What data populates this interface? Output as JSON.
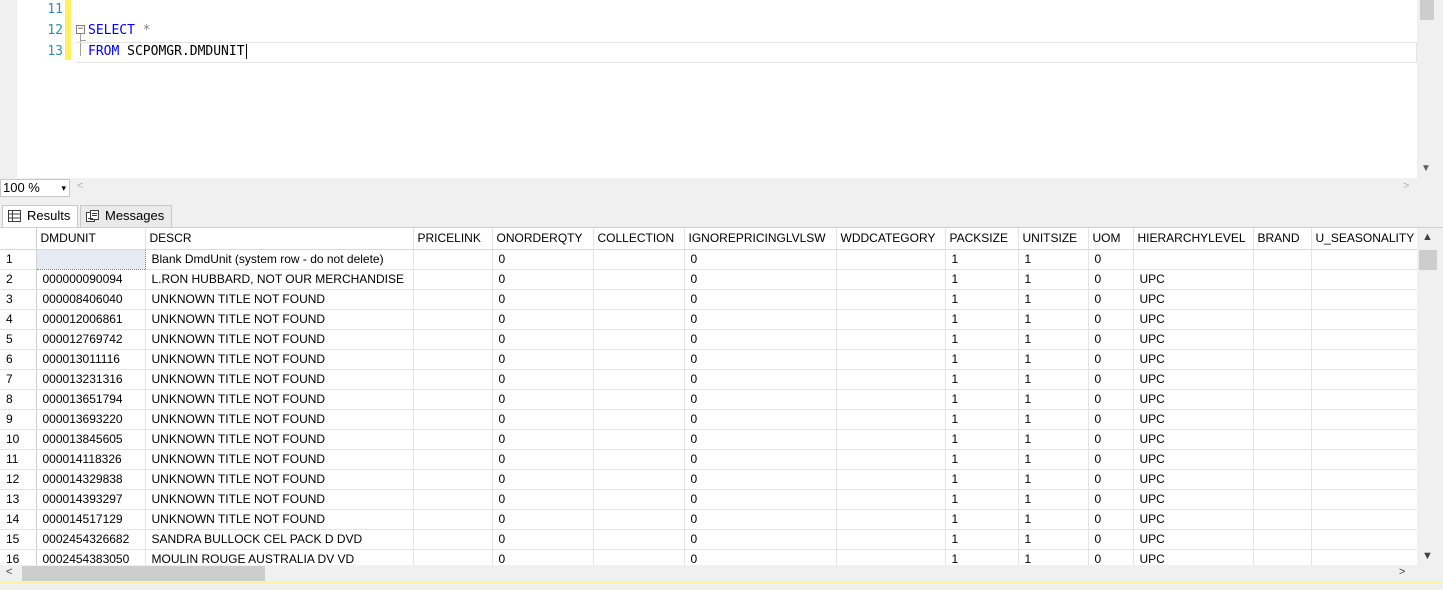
{
  "editor": {
    "line_numbers": [
      "11",
      "12",
      "13"
    ],
    "code": {
      "select_kw": "SELECT",
      "star": "*",
      "from_kw": "FROM",
      "table_name": "SCPOMGR.DMDUNIT"
    },
    "fold_glyph": "−"
  },
  "zoom": {
    "value": "100 %",
    "dropdown_glyph": "▾"
  },
  "tabs": {
    "results": "Results",
    "messages": "Messages"
  },
  "grid": {
    "columns": [
      "DMDUNIT",
      "DESCR",
      "PRICELINK",
      "ONORDERQTY",
      "COLLECTION",
      "IGNOREPRICINGLVLSW",
      "WDDCATEGORY",
      "PACKSIZE",
      "UNITSIZE",
      "UOM",
      "HIERARCHYLEVEL",
      "BRAND",
      "U_SEASONALITY"
    ],
    "rows": [
      [
        "1",
        "",
        "Blank DmdUnit (system row - do not delete)",
        "",
        "0",
        "",
        "0",
        "",
        "1",
        "1",
        "0",
        "",
        "",
        ""
      ],
      [
        "2",
        "000000090094",
        "L.RON HUBBARD, NOT OUR MERCHANDISE",
        "",
        "0",
        "",
        "0",
        "",
        "1",
        "1",
        "0",
        "UPC",
        "",
        ""
      ],
      [
        "3",
        "000008406040",
        "UNKNOWN TITLE NOT FOUND",
        "",
        "0",
        "",
        "0",
        "",
        "1",
        "1",
        "0",
        "UPC",
        "",
        ""
      ],
      [
        "4",
        "000012006861",
        "UNKNOWN TITLE NOT FOUND",
        "",
        "0",
        "",
        "0",
        "",
        "1",
        "1",
        "0",
        "UPC",
        "",
        ""
      ],
      [
        "5",
        "000012769742",
        "UNKNOWN TITLE NOT FOUND",
        "",
        "0",
        "",
        "0",
        "",
        "1",
        "1",
        "0",
        "UPC",
        "",
        ""
      ],
      [
        "6",
        "000013011116",
        "UNKNOWN TITLE NOT FOUND",
        "",
        "0",
        "",
        "0",
        "",
        "1",
        "1",
        "0",
        "UPC",
        "",
        ""
      ],
      [
        "7",
        "000013231316",
        "UNKNOWN TITLE NOT FOUND",
        "",
        "0",
        "",
        "0",
        "",
        "1",
        "1",
        "0",
        "UPC",
        "",
        ""
      ],
      [
        "8",
        "000013651794",
        "UNKNOWN TITLE NOT FOUND",
        "",
        "0",
        "",
        "0",
        "",
        "1",
        "1",
        "0",
        "UPC",
        "",
        ""
      ],
      [
        "9",
        "000013693220",
        "UNKNOWN TITLE NOT FOUND",
        "",
        "0",
        "",
        "0",
        "",
        "1",
        "1",
        "0",
        "UPC",
        "",
        ""
      ],
      [
        "10",
        "000013845605",
        "UNKNOWN TITLE NOT FOUND",
        "",
        "0",
        "",
        "0",
        "",
        "1",
        "1",
        "0",
        "UPC",
        "",
        ""
      ],
      [
        "11",
        "000014118326",
        "UNKNOWN TITLE NOT FOUND",
        "",
        "0",
        "",
        "0",
        "",
        "1",
        "1",
        "0",
        "UPC",
        "",
        ""
      ],
      [
        "12",
        "000014329838",
        "UNKNOWN TITLE NOT FOUND",
        "",
        "0",
        "",
        "0",
        "",
        "1",
        "1",
        "0",
        "UPC",
        "",
        ""
      ],
      [
        "13",
        "000014393297",
        "UNKNOWN TITLE NOT FOUND",
        "",
        "0",
        "",
        "0",
        "",
        "1",
        "1",
        "0",
        "UPC",
        "",
        ""
      ],
      [
        "14",
        "000014517129",
        "UNKNOWN TITLE NOT FOUND",
        "",
        "0",
        "",
        "0",
        "",
        "1",
        "1",
        "0",
        "UPC",
        "",
        ""
      ],
      [
        "15",
        "0002454326682",
        "SANDRA BULLOCK CEL PACK D DVD",
        "",
        "0",
        "",
        "0",
        "",
        "1",
        "1",
        "0",
        "UPC",
        "",
        ""
      ],
      [
        "16",
        "0002454383050",
        "MOULIN ROUGE AUSTRALIA DV VD",
        "",
        "0",
        "",
        "0",
        "",
        "1",
        "1",
        "0",
        "UPC",
        "",
        ""
      ]
    ]
  },
  "scroll": {
    "up": "▲",
    "down": "▼",
    "left": "<",
    "right": ">"
  }
}
